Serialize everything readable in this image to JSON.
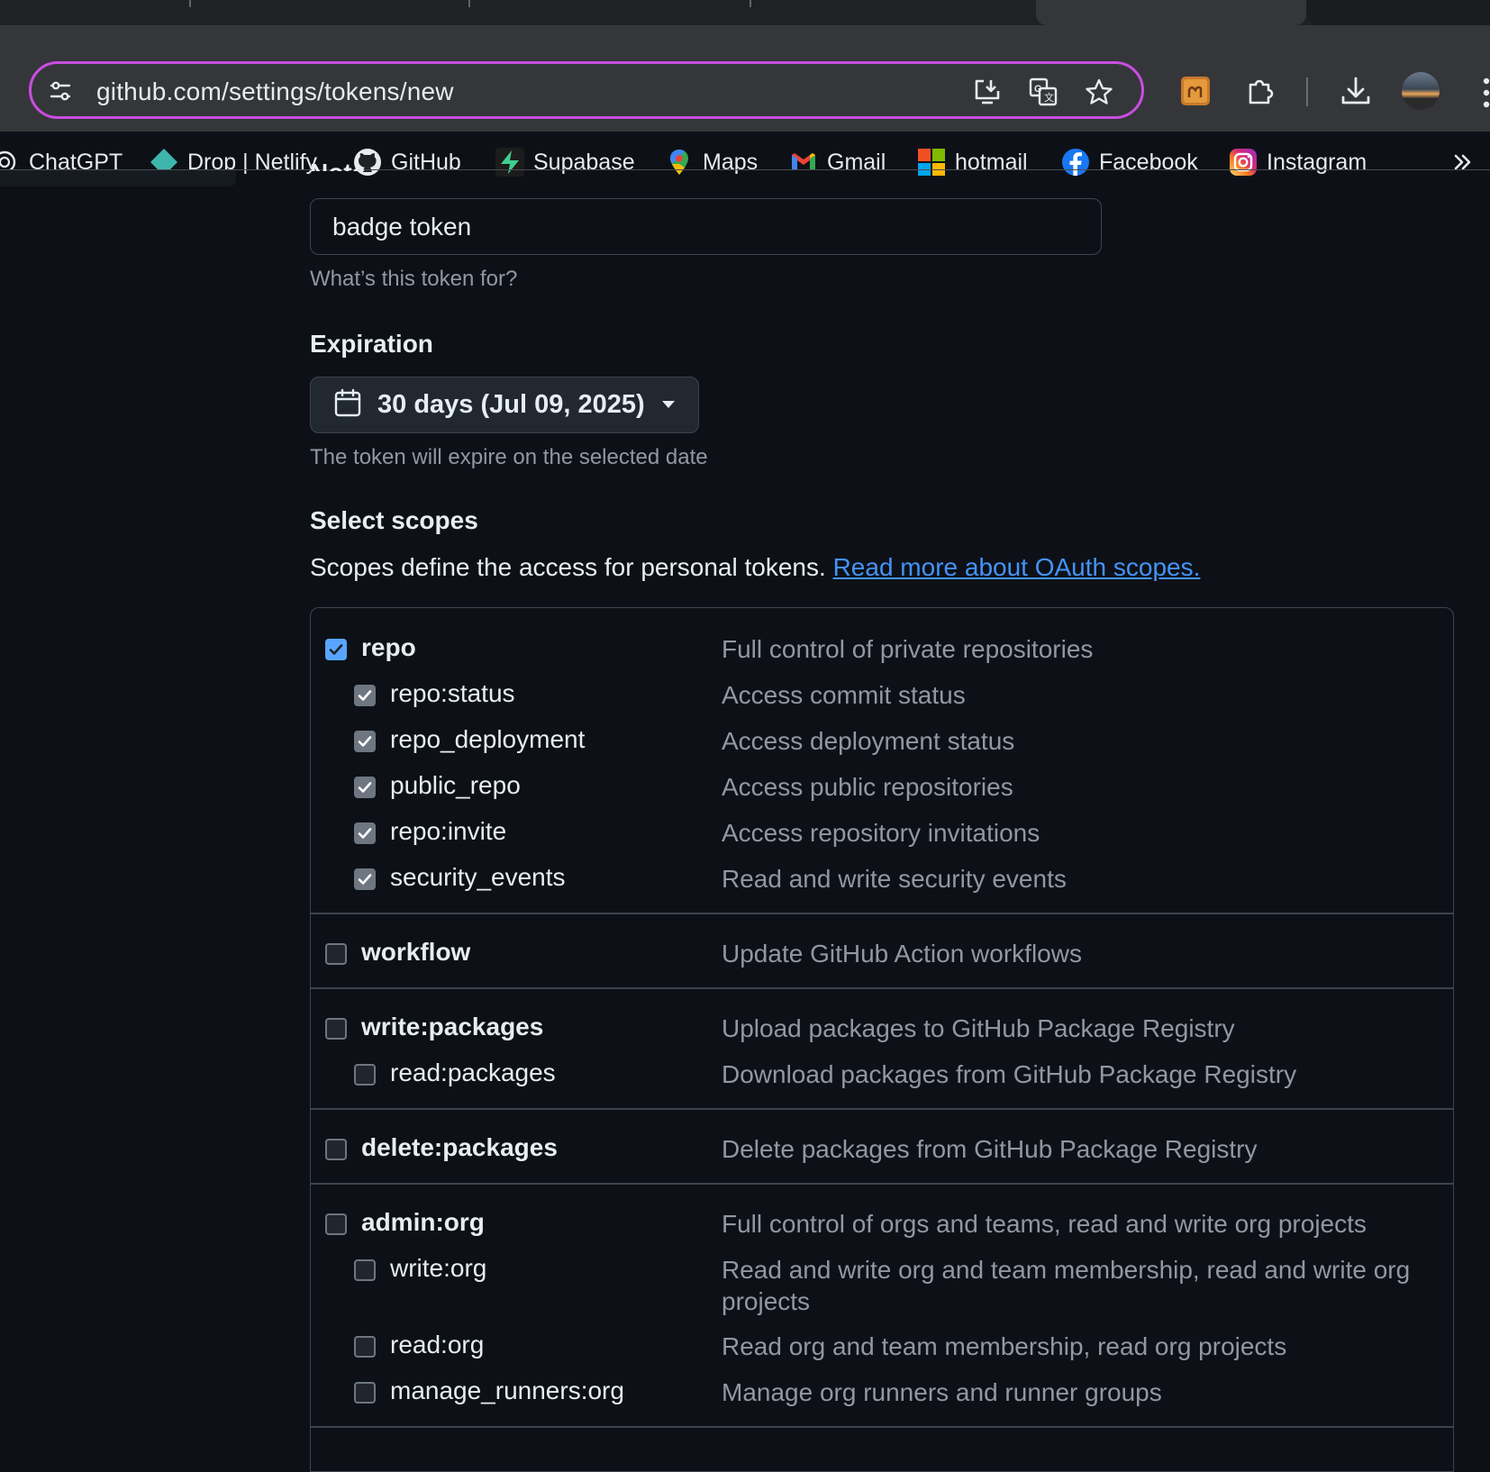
{
  "browser": {
    "url": "github.com/settings/tokens/new",
    "bookmarks": [
      {
        "label": "ChatGPT",
        "icon": "chatgpt-icon"
      },
      {
        "label": "Drop | Netlify",
        "icon": "netlify-icon"
      },
      {
        "label": "GitHub",
        "icon": "github-icon"
      },
      {
        "label": "Supabase",
        "icon": "supabase-icon"
      },
      {
        "label": "Maps",
        "icon": "maps-icon"
      },
      {
        "label": "Gmail",
        "icon": "gmail-icon"
      },
      {
        "label": "hotmail",
        "icon": "microsoft-icon"
      },
      {
        "label": "Facebook",
        "icon": "facebook-icon"
      },
      {
        "label": "Instagram",
        "icon": "instagram-icon"
      }
    ],
    "accent_color": "#c94ee0"
  },
  "form": {
    "note_label": "Note",
    "note_value": "badge token",
    "note_hint": "What’s this token for?",
    "expiration_label": "Expiration",
    "expiration_value": "30 days (Jul 09, 2025)",
    "expiration_hint": "The token will expire on the selected date",
    "scopes_heading": "Select scopes",
    "scopes_description": "Scopes define the access for personal tokens.",
    "scopes_link": "Read more about OAuth scopes."
  },
  "scopes": {
    "repo": {
      "name": "repo",
      "desc": "Full control of private repositories",
      "checked": true
    },
    "repo_status": {
      "name": "repo:status",
      "desc": "Access commit status",
      "checked": true
    },
    "repo_deployment": {
      "name": "repo_deployment",
      "desc": "Access deployment status",
      "checked": true
    },
    "public_repo": {
      "name": "public_repo",
      "desc": "Access public repositories",
      "checked": true
    },
    "repo_invite": {
      "name": "repo:invite",
      "desc": "Access repository invitations",
      "checked": true
    },
    "security_events": {
      "name": "security_events",
      "desc": "Read and write security events",
      "checked": true
    },
    "workflow": {
      "name": "workflow",
      "desc": "Update GitHub Action workflows",
      "checked": false
    },
    "write_packages": {
      "name": "write:packages",
      "desc": "Upload packages to GitHub Package Registry",
      "checked": false
    },
    "read_packages": {
      "name": "read:packages",
      "desc": "Download packages from GitHub Package Registry",
      "checked": false
    },
    "delete_packages": {
      "name": "delete:packages",
      "desc": "Delete packages from GitHub Package Registry",
      "checked": false
    },
    "admin_org": {
      "name": "admin:org",
      "desc": "Full control of orgs and teams, read and write org projects",
      "checked": false
    },
    "write_org": {
      "name": "write:org",
      "desc": "Read and write org and team membership, read and write org projects",
      "checked": false
    },
    "read_org": {
      "name": "read:org",
      "desc": "Read org and team membership, read org projects",
      "checked": false
    },
    "manage_runners_org": {
      "name": "manage_runners:org",
      "desc": "Manage org runners and runner groups",
      "checked": false
    }
  }
}
